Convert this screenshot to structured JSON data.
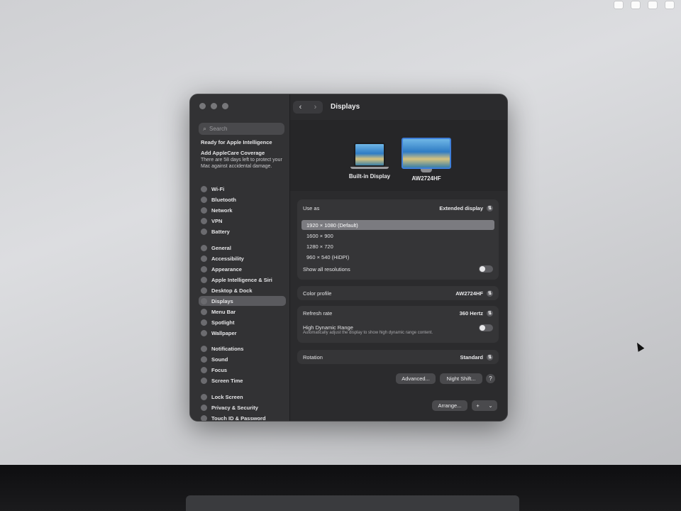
{
  "sidebar": {
    "search_placeholder": "Search",
    "promos": [
      {
        "title": "Ready for Apple Intelligence"
      },
      {
        "title": "Add AppleCare Coverage",
        "body": "There are 58 days left to protect your Mac against accidental damage."
      }
    ],
    "items": [
      {
        "label": "Wi-Fi",
        "icon": "wifi-icon"
      },
      {
        "label": "Bluetooth",
        "icon": "bluetooth-icon"
      },
      {
        "label": "Network",
        "icon": "network-icon"
      },
      {
        "label": "VPN",
        "icon": "vpn-icon"
      },
      {
        "label": "Battery",
        "icon": "battery-icon"
      },
      {
        "label": "General",
        "icon": "gear-icon"
      },
      {
        "label": "Accessibility",
        "icon": "accessibility-icon"
      },
      {
        "label": "Appearance",
        "icon": "appearance-icon"
      },
      {
        "label": "Apple Intelligence & Siri",
        "icon": "siri-icon"
      },
      {
        "label": "Desktop & Dock",
        "icon": "desktop-dock-icon"
      },
      {
        "label": "Displays",
        "icon": "displays-icon",
        "selected": true
      },
      {
        "label": "Menu Bar",
        "icon": "menu-bar-icon"
      },
      {
        "label": "Spotlight",
        "icon": "spotlight-icon"
      },
      {
        "label": "Wallpaper",
        "icon": "wallpaper-icon"
      },
      {
        "label": "Notifications",
        "icon": "notifications-icon"
      },
      {
        "label": "Sound",
        "icon": "sound-icon"
      },
      {
        "label": "Focus",
        "icon": "focus-icon"
      },
      {
        "label": "Screen Time",
        "icon": "screen-time-icon"
      },
      {
        "label": "Lock Screen",
        "icon": "lock-icon"
      },
      {
        "label": "Privacy & Security",
        "icon": "privacy-hand-icon"
      },
      {
        "label": "Touch ID & Password",
        "icon": "fingerprint-icon"
      }
    ]
  },
  "header": {
    "title": "Displays"
  },
  "displays": [
    {
      "name": "Built-in Display"
    },
    {
      "name": "AW2724HF",
      "selected": true
    }
  ],
  "settings": {
    "use_as": {
      "label": "Use as",
      "value": "Extended display"
    },
    "resolutions": [
      "1920 × 1080 (Default)",
      "1600 × 900",
      "1280 × 720",
      "960 × 540 (HiDPI)"
    ],
    "selected_resolution": "1920 × 1080 (Default)",
    "show_all_resolutions": {
      "label": "Show all resolutions",
      "on": false
    },
    "color_profile": {
      "label": "Color profile",
      "value": "AW2724HF"
    },
    "refresh_rate": {
      "label": "Refresh rate",
      "value": "360 Hertz"
    },
    "hdr": {
      "label": "High Dynamic Range",
      "description": "Automatically adjust the display to show high dynamic range content.",
      "on": false
    },
    "rotation": {
      "label": "Rotation",
      "value": "Standard"
    }
  },
  "buttons": {
    "advanced": "Advanced...",
    "night_shift": "Night Shift...",
    "help": "?",
    "arrange": "Arrange...",
    "add": "+",
    "add_menu": "⌄"
  }
}
